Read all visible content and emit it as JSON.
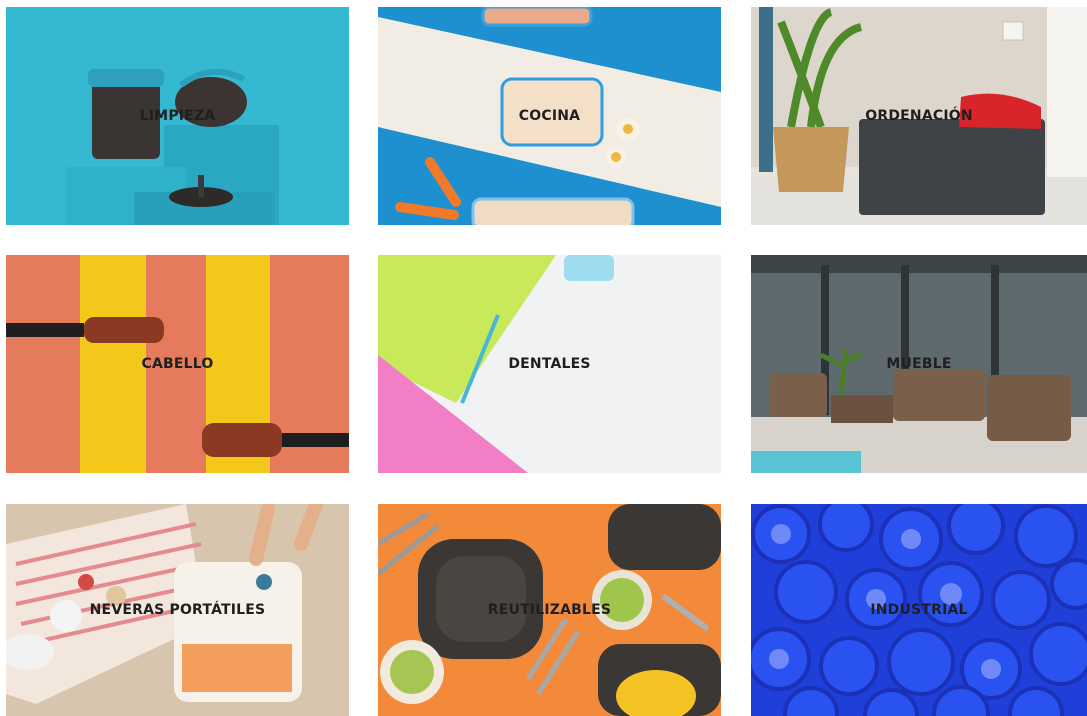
{
  "categories": [
    {
      "label": "LIMPIEZA",
      "icon": "cleaning-products-photo"
    },
    {
      "label": "COCINA",
      "icon": "kitchen-containers-photo"
    },
    {
      "label": "ORDENACIÓN",
      "icon": "storage-box-photo"
    },
    {
      "label": "CABELLO",
      "icon": "hair-brushes-photo"
    },
    {
      "label": "DENTALES",
      "icon": "dental-products-photo"
    },
    {
      "label": "MUEBLE",
      "icon": "outdoor-furniture-photo"
    },
    {
      "label": "NEVERAS PORTÁTILES",
      "icon": "portable-cooler-photo"
    },
    {
      "label": "REUTILIZABLES",
      "icon": "reusable-tableware-photo"
    },
    {
      "label": "INDUSTRIAL",
      "icon": "industrial-caps-photo"
    }
  ],
  "colors": {
    "limpieza_bg": "#35b9d3",
    "cocina_blue": "#1e8fcf",
    "ordenacion_wall": "#e7e4de",
    "cabello_bg": "#e57a5c",
    "cabello_stripe": "#f4c71b",
    "dentales_green": "#c7e95a",
    "dentales_pink": "#f27fc6",
    "mueble_wall": "#5f6a6e",
    "neveras_sand": "#d8c5ad",
    "reutil_bg": "#f28a3a",
    "industrial_blue": "#1f3fd8"
  }
}
